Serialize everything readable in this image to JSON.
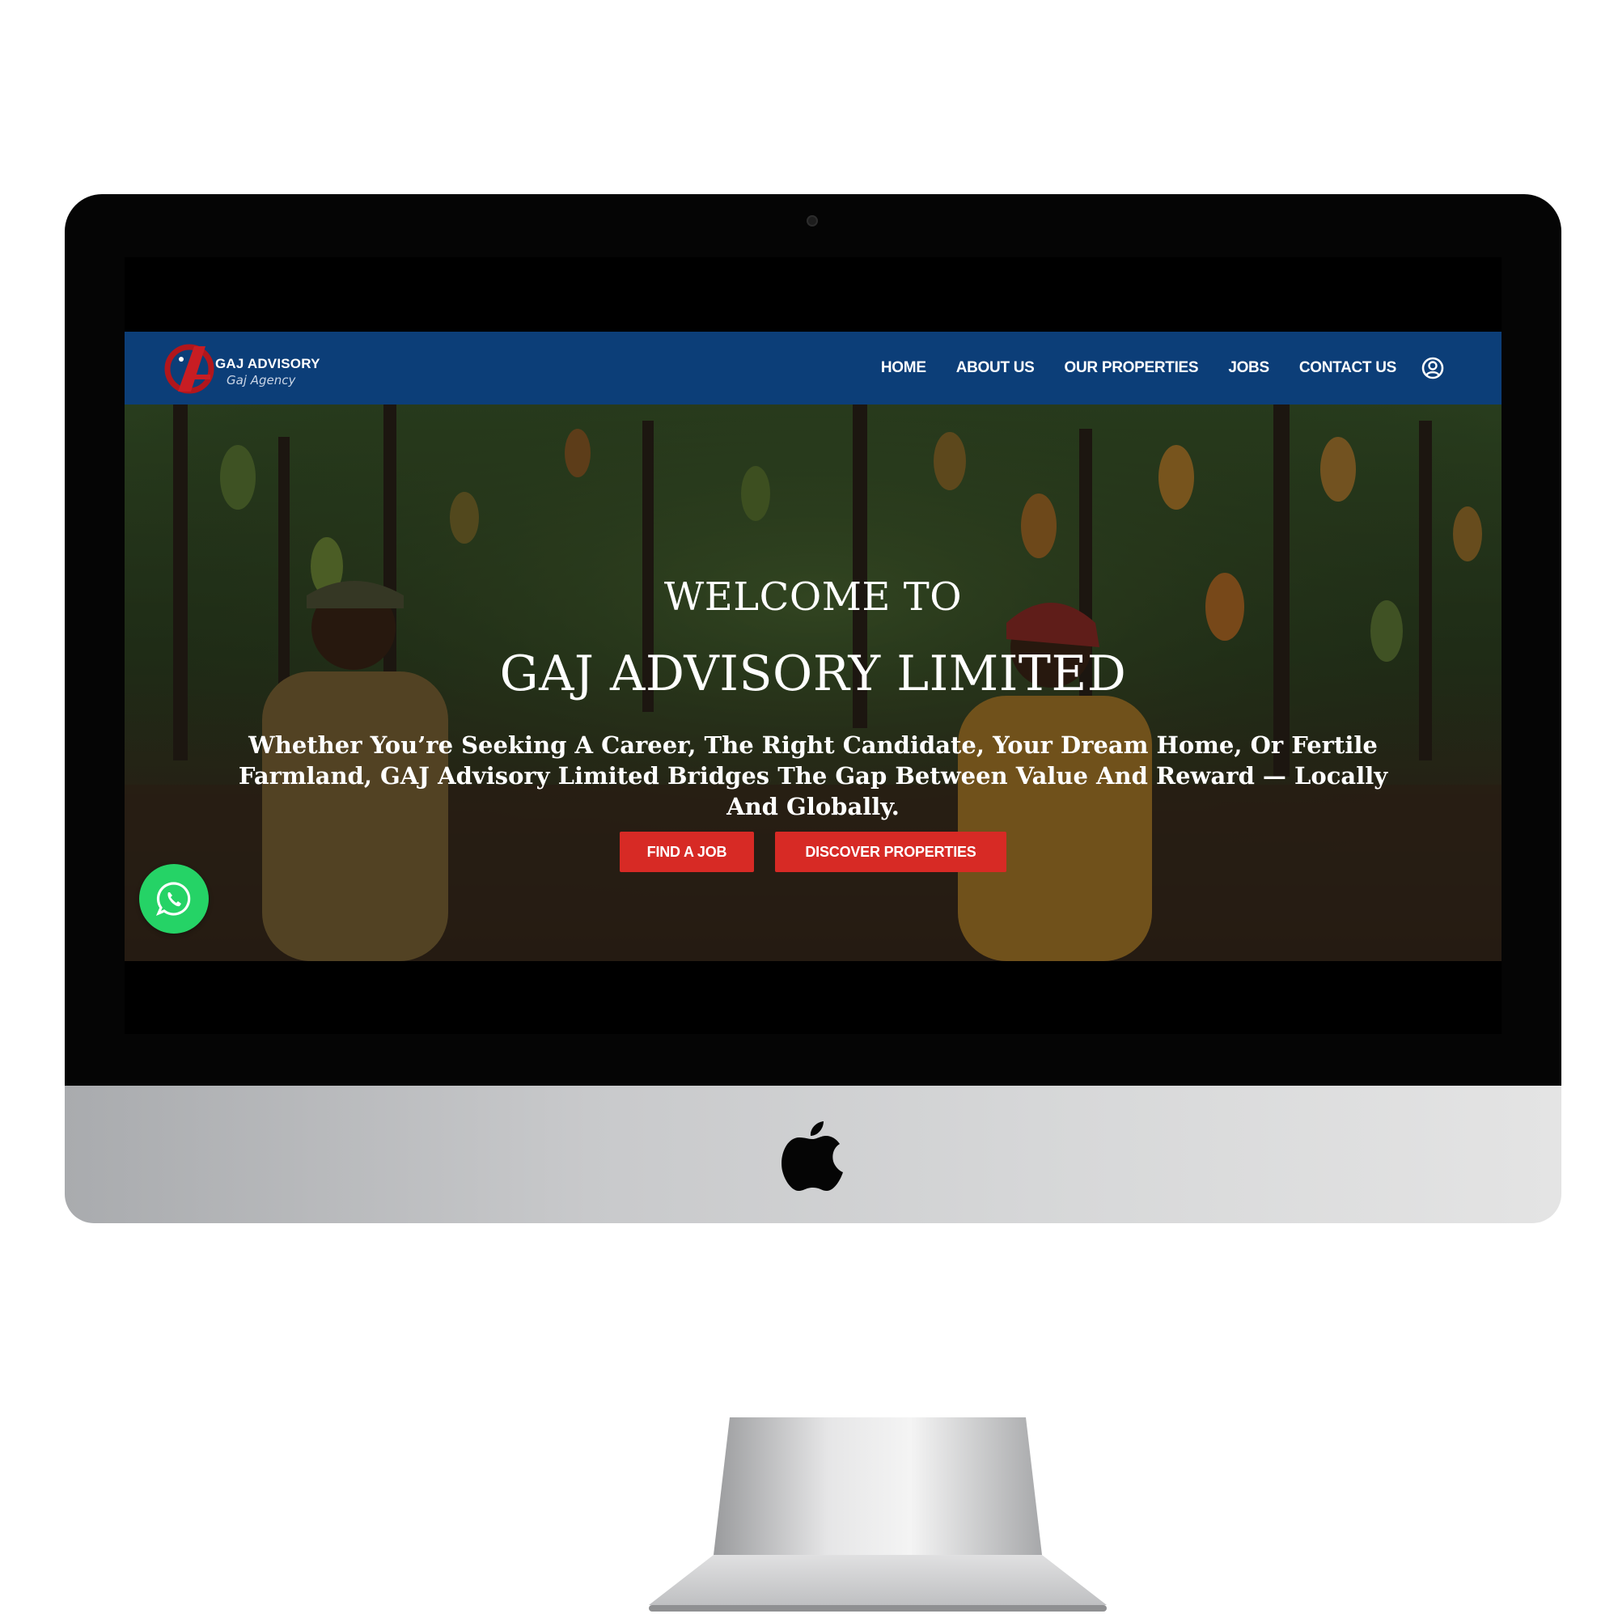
{
  "site": {
    "brand": {
      "name": "GAJ ADVISORY",
      "tagline": "Gaj Agency",
      "colors": {
        "nav_bg": "#0c3e78",
        "accent_red": "#d72a25",
        "whatsapp_green": "#25d366"
      }
    },
    "nav": {
      "items": [
        {
          "label": "HOME"
        },
        {
          "label": "ABOUT US"
        },
        {
          "label": "OUR PROPERTIES"
        },
        {
          "label": "JOBS"
        },
        {
          "label": "CONTACT US"
        }
      ],
      "account_icon": "user-circle-icon"
    },
    "hero": {
      "welcome": "WELCOME TO",
      "title": "GAJ ADVISORY LIMITED",
      "description": "Whether You’re Seeking A Career, The Right Candidate, Your Dream Home, Or Fertile Farmland, GAJ Advisory Limited Bridges The Gap Between Value And Reward — Locally And Globally.",
      "buttons": {
        "find_job": "FIND A JOB",
        "discover_properties": "DISCOVER PROPERTIES"
      }
    },
    "floating": {
      "whatsapp_icon": "whatsapp-icon"
    }
  },
  "device": {
    "logo_icon": "apple-logo-icon"
  }
}
